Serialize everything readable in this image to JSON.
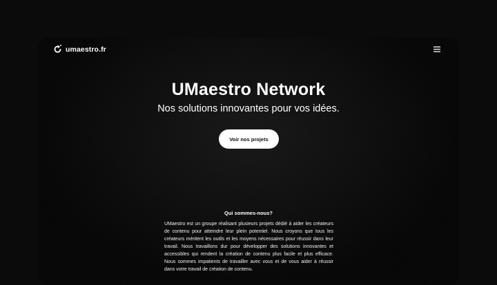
{
  "nav": {
    "brand": "umaestro.fr",
    "brand_icon": "refresh-arrow-icon",
    "menu_icon": "hamburger-menu-icon"
  },
  "hero": {
    "title": "UMaestro Network",
    "subtitle": "Nos solutions innovantes pour vos idées.",
    "cta_label": "Voir nos projets"
  },
  "about": {
    "title": "Qui sommes-nous?",
    "text": "UMaestro est un groupe réalisant plusieurs projets dédié à aider les créateurs de contenu pour atteindre leur plein potentiel. Nous croyons que tous les créateurs méritent les outils et les moyens nécessaires pour réussir dans leur travail. Nous travaillons dur pour développer des solutions innovantes et accessibles qui rendent la création de contenu plus facile et plus efficace. Nous sommes impatients de travailler avec vous et de vous aider à réussir dans votre travail de création de contenu."
  },
  "colors": {
    "background": "#0b0b0b",
    "panel": "#050505",
    "button": "#ffffff",
    "button_text": "#111111"
  }
}
